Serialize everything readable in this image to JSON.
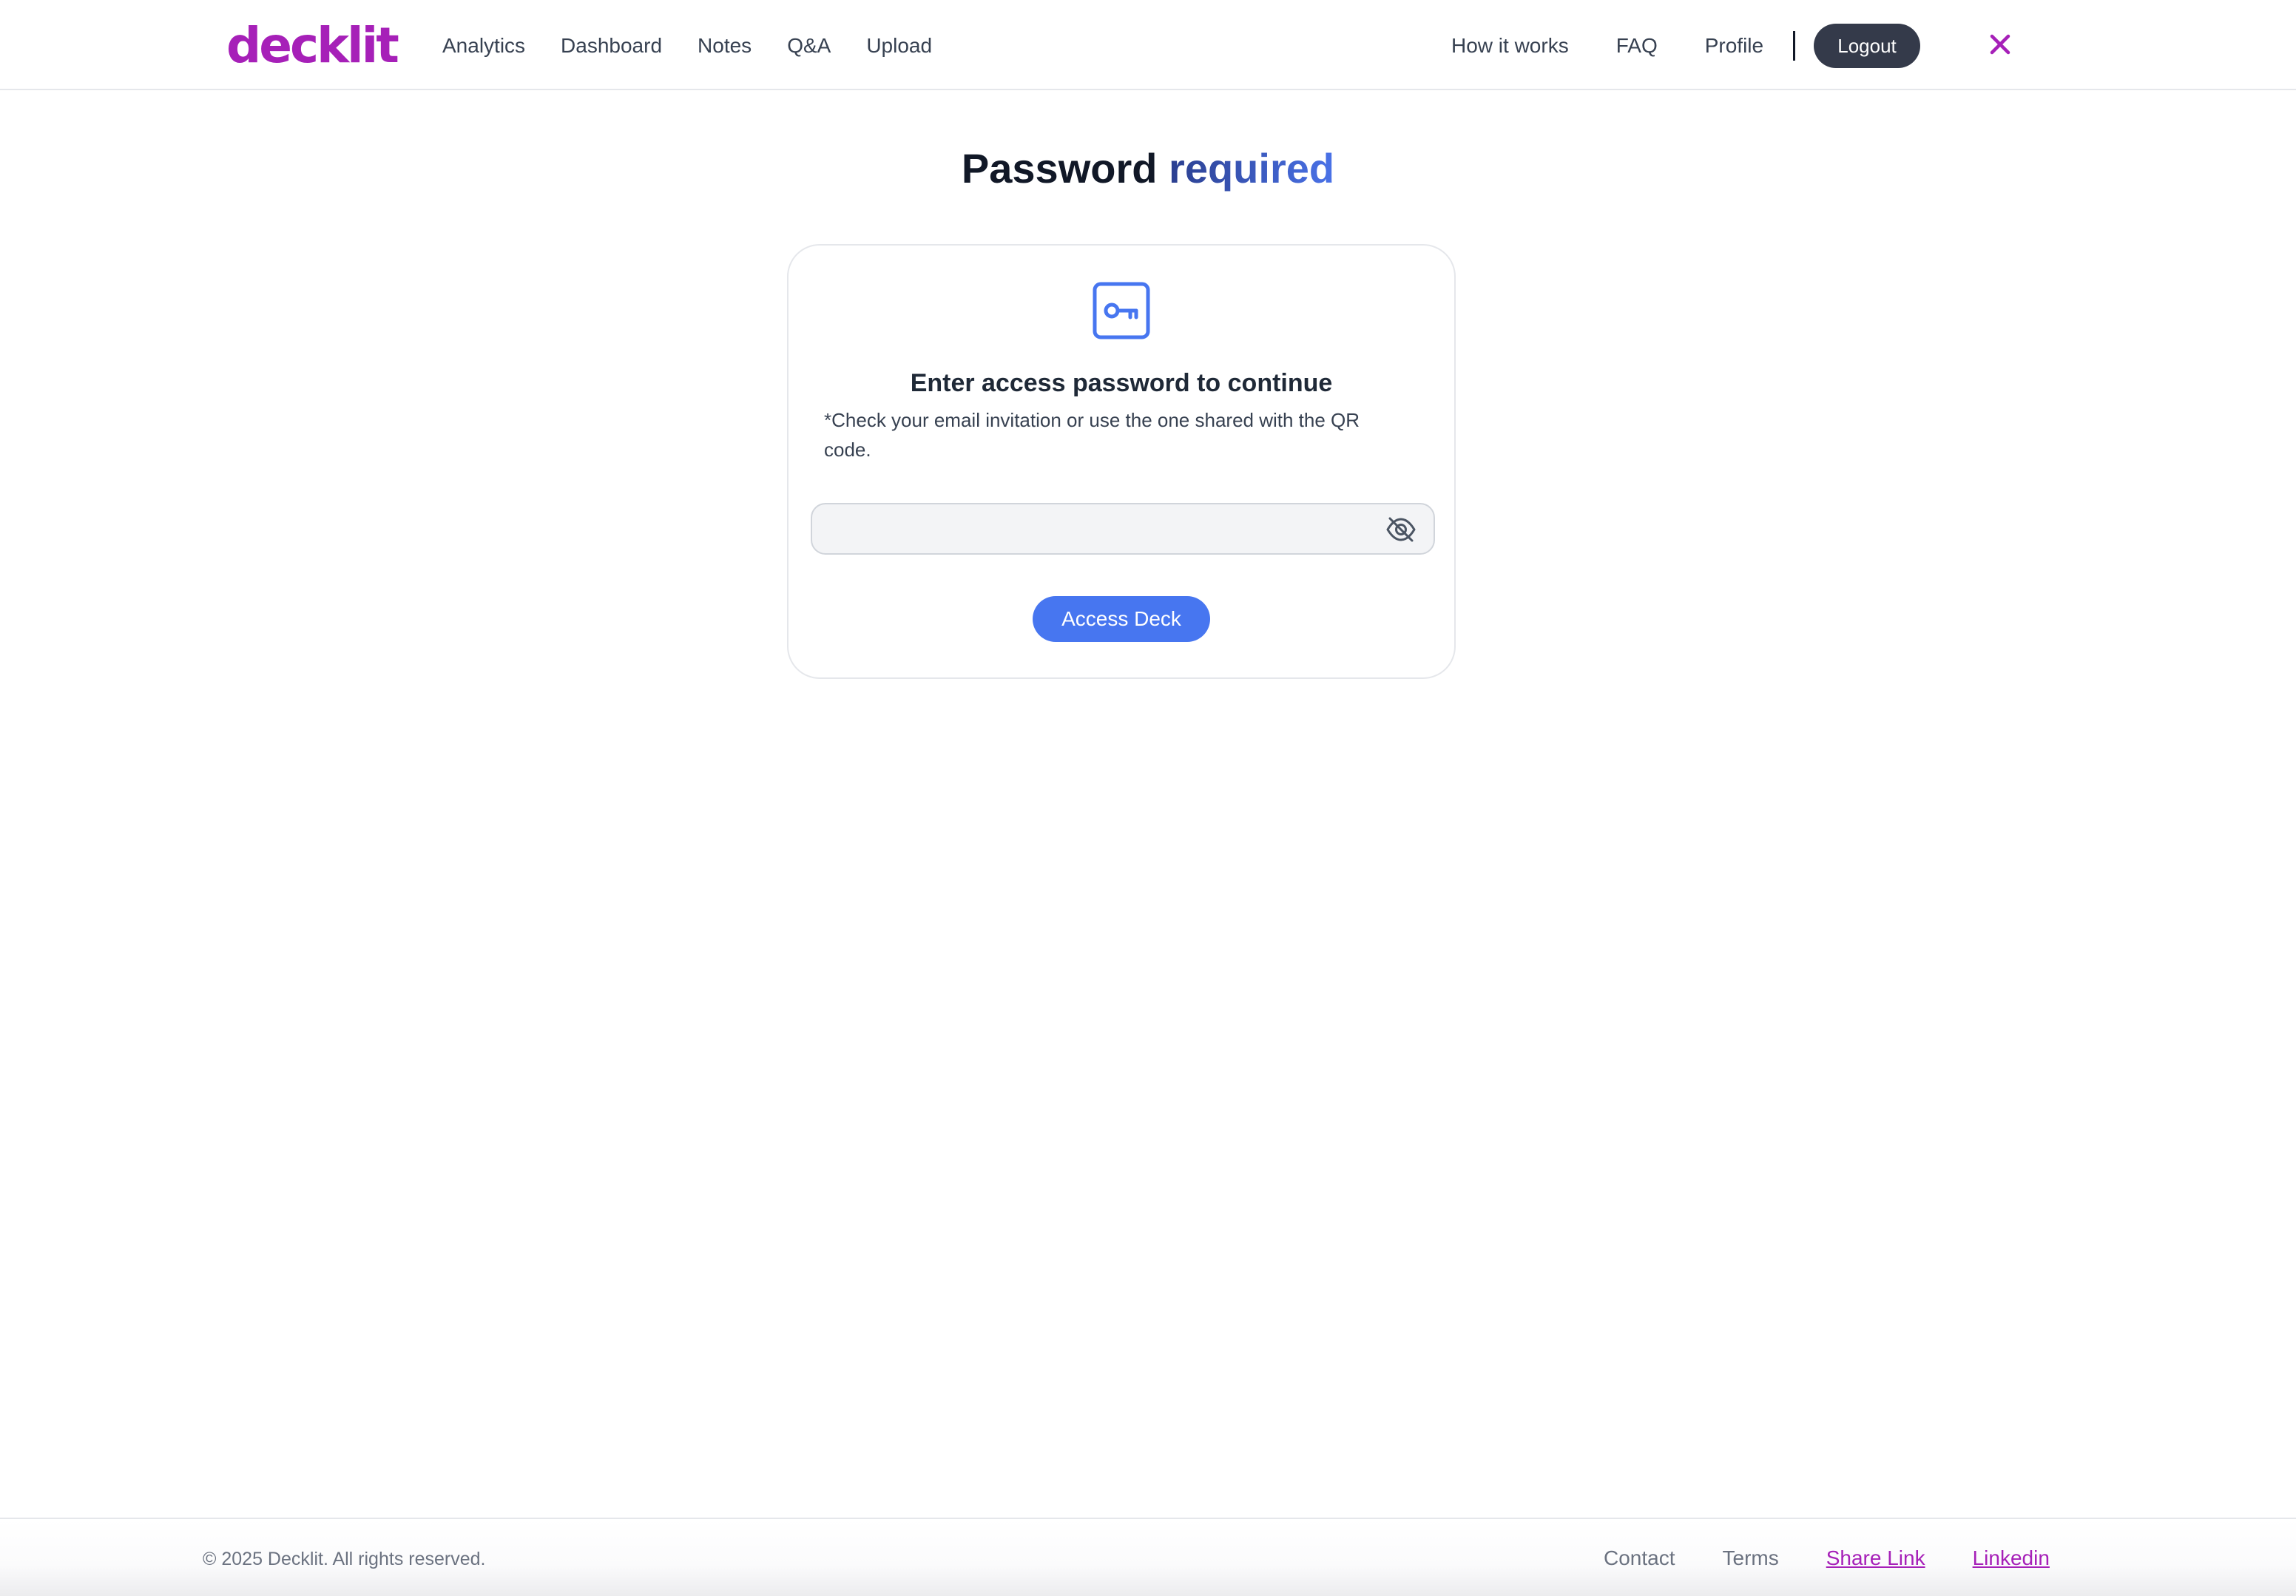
{
  "brand": {
    "logo_text": "decklit",
    "color": "#a620b8"
  },
  "nav": {
    "left": [
      {
        "label": "Analytics"
      },
      {
        "label": "Dashboard"
      },
      {
        "label": "Notes"
      },
      {
        "label": "Q&A"
      },
      {
        "label": "Upload"
      }
    ],
    "right": [
      {
        "label": "How it works"
      },
      {
        "label": "FAQ"
      },
      {
        "label": "Profile"
      }
    ],
    "logout_label": "Logout",
    "close_icon": "close-icon"
  },
  "main": {
    "title_prefix": "Password",
    "title_accent": "required",
    "card": {
      "icon": "key-icon",
      "heading": "Enter access password to continue",
      "note": "*Check your email invitation or use the one shared with the QR code.",
      "password_value": "",
      "password_placeholder": "",
      "toggle_icon": "eye-off-icon",
      "submit_label": "Access Deck"
    }
  },
  "footer": {
    "copyright": "© 2025 Decklit. All rights reserved.",
    "links": [
      {
        "label": "Contact"
      },
      {
        "label": "Terms"
      },
      {
        "label": "Share Link"
      },
      {
        "label": "Linkedin"
      }
    ]
  },
  "colors": {
    "accent_blue": "#4776f0",
    "logout_bg": "#343a4a",
    "title_gradient_start": "#2b3f8f",
    "title_gradient_end": "#4a72e8"
  }
}
